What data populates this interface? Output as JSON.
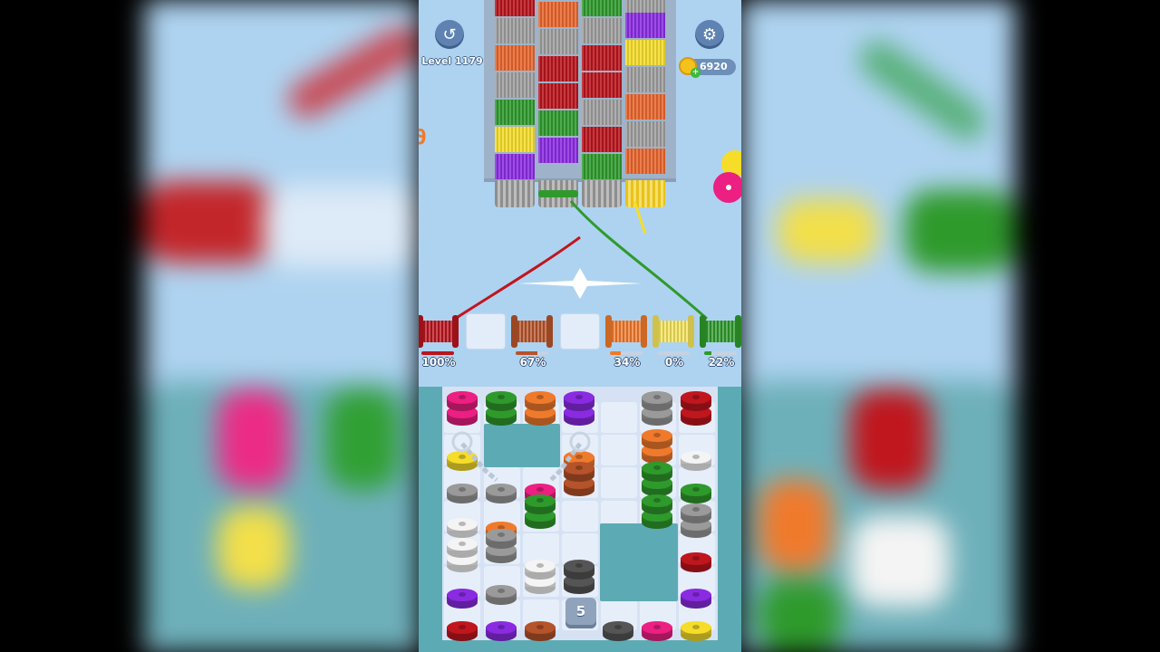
{
  "game": {
    "level_label": "Level 1179",
    "coins": "6920",
    "locked_count": "5"
  },
  "hud_icons": {
    "undo": "undo-arrow-icon",
    "settings": "gear-icon",
    "coin": "coin-icon",
    "add": "plus-icon"
  },
  "spools": [
    {
      "color": "#b9141c",
      "progress": 100,
      "label": "100%"
    },
    {
      "color": "#b5532a",
      "progress": 67,
      "label": "67%"
    },
    {
      "color": "#f07a2c",
      "progress": 34,
      "label": "34%"
    },
    {
      "color": "#f5e35a",
      "progress": 0,
      "label": "0%"
    },
    {
      "color": "#2f9a2c",
      "progress": 22,
      "label": "22%"
    }
  ],
  "colors": {
    "sky": "#aed3f1",
    "board": "#5cabb4",
    "red": "#c0161e",
    "green": "#2f9a2c",
    "yellow": "#f5dd2a",
    "pink": "#ec1f82",
    "orange": "#f07a2c",
    "purple": "#8a2be2",
    "gray": "#9a9a9a",
    "white": "#f4f4f4",
    "brown": "#b5532a",
    "dark": "#555555"
  }
}
